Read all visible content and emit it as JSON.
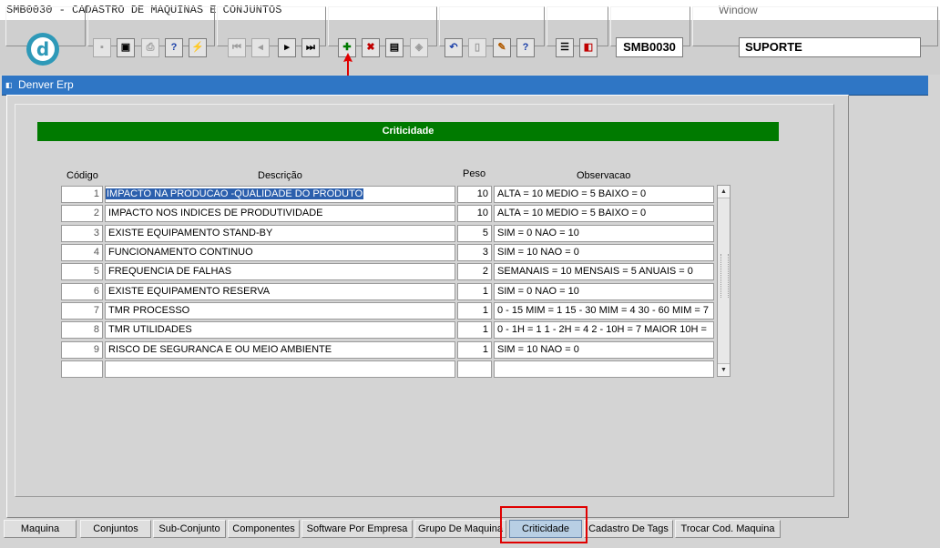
{
  "app": {
    "title": "SMB0030 - CADASTRO DE MAQUINAS E CONJUNTOS",
    "window_menu": "Window"
  },
  "toolbar": {
    "logo_letter": "d",
    "form_code": "SMB0030",
    "user": "SUPORTE",
    "buttons": [
      {
        "name": "save-icon",
        "glyph": "▪"
      },
      {
        "name": "print-preview-icon",
        "glyph": "▣"
      },
      {
        "name": "print-icon",
        "glyph": "⎙"
      },
      {
        "name": "help-query-icon",
        "glyph": "?"
      },
      {
        "name": "execute-query-icon",
        "glyph": "⚡"
      },
      {
        "name": "first-record-icon",
        "glyph": "⏮"
      },
      {
        "name": "previous-record-icon",
        "glyph": "◂"
      },
      {
        "name": "next-record-icon",
        "glyph": "▸"
      },
      {
        "name": "last-record-icon",
        "glyph": "⏭"
      },
      {
        "name": "insert-record-icon",
        "glyph": "✚"
      },
      {
        "name": "delete-record-icon",
        "glyph": "✖"
      },
      {
        "name": "clear-form-icon",
        "glyph": "▤"
      },
      {
        "name": "duplicate-icon",
        "glyph": "◈"
      },
      {
        "name": "undo-icon",
        "glyph": "↶"
      },
      {
        "name": "paste-icon",
        "glyph": "▯"
      },
      {
        "name": "edit-icon",
        "glyph": "✎"
      },
      {
        "name": "help-icon",
        "glyph": "?"
      },
      {
        "name": "menu-icon",
        "glyph": "☰"
      },
      {
        "name": "exit-icon",
        "glyph": "◧"
      }
    ],
    "colors": {
      "insert": "#007a00",
      "delete": "#c00000",
      "help": "#1a3fa8"
    }
  },
  "window": {
    "title": "Denver Erp"
  },
  "section": {
    "title": "Criticidade"
  },
  "table": {
    "headers": {
      "codigo": "Código",
      "descricao": "Descrição",
      "peso": "Peso",
      "observacao": "Observacao"
    },
    "rows": [
      {
        "codigo": "1",
        "descricao": "IMPACTO NA PRODUCAO -QUALIDADE DO PRODUTO",
        "peso": "10",
        "observacao": "ALTA = 10  MEDIO = 5  BAIXO = 0"
      },
      {
        "codigo": "2",
        "descricao": "IMPACTO NOS INDICES DE PRODUTIVIDADE",
        "peso": "10",
        "observacao": "ALTA = 10  MEDIO = 5  BAIXO = 0"
      },
      {
        "codigo": "3",
        "descricao": "EXISTE EQUIPAMENTO STAND-BY",
        "peso": "5",
        "observacao": "SIM = 0  NAO = 10"
      },
      {
        "codigo": "4",
        "descricao": "FUNCIONAMENTO CONTINUO",
        "peso": "3",
        "observacao": "SIM = 10 NAO = 0"
      },
      {
        "codigo": "5",
        "descricao": "FREQUENCIA DE FALHAS",
        "peso": "2",
        "observacao": "SEMANAIS = 10  MENSAIS = 5  ANUAIS = 0"
      },
      {
        "codigo": "6",
        "descricao": "EXISTE EQUIPAMENTO RESERVA",
        "peso": "1",
        "observacao": "SIM = 0  NAO = 10"
      },
      {
        "codigo": "7",
        "descricao": "TMR PROCESSO",
        "peso": "1",
        "observacao": "0 - 15 MIM = 1   15 - 30 MIM = 4   30 - 60 MIM = 7"
      },
      {
        "codigo": "8",
        "descricao": "TMR UTILIDADES",
        "peso": "1",
        "observacao": "0 - 1H = 1  1 - 2H = 4    2 - 10H = 7  MAIOR 10H ="
      },
      {
        "codigo": "9",
        "descricao": "RISCO DE SEGURANCA E OU MEIO AMBIENTE",
        "peso": "1",
        "observacao": "SIM = 10  NAO = 0"
      },
      {
        "codigo": "",
        "descricao": "",
        "peso": "",
        "observacao": ""
      }
    ]
  },
  "tabs": [
    {
      "label": "Maquina"
    },
    {
      "label": "Conjuntos"
    },
    {
      "label": "Sub-Conjunto"
    },
    {
      "label": "Componentes"
    },
    {
      "label": "Software Por Empresa"
    },
    {
      "label": "Grupo De Maquina"
    },
    {
      "label": "Criticidade",
      "active": true
    },
    {
      "label": "Cadastro De Tags"
    },
    {
      "label": "Trocar Cod. Maquina"
    }
  ],
  "annotation": {
    "color": "#e00000"
  }
}
